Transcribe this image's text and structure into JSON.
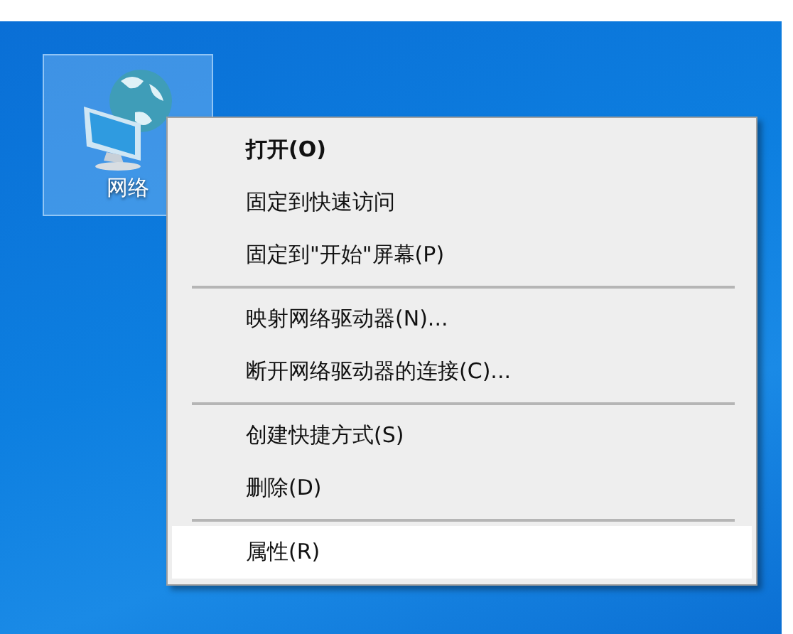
{
  "desktop_icons": [
    {
      "label": "网络",
      "selected": true
    }
  ],
  "context_menu": {
    "groups": [
      [
        {
          "label": "打开(O)",
          "default": true,
          "selected": false
        },
        {
          "label": "固定到快速访问",
          "default": false,
          "selected": false
        },
        {
          "label": "固定到\"开始\"屏幕(P)",
          "default": false,
          "selected": false
        }
      ],
      [
        {
          "label": "映射网络驱动器(N)...",
          "default": false,
          "selected": false
        },
        {
          "label": "断开网络驱动器的连接(C)...",
          "default": false,
          "selected": false
        }
      ],
      [
        {
          "label": "创建快捷方式(S)",
          "default": false,
          "selected": false
        },
        {
          "label": "删除(D)",
          "default": false,
          "selected": false
        }
      ],
      [
        {
          "label": "属性(R)",
          "default": false,
          "selected": true
        }
      ]
    ]
  }
}
